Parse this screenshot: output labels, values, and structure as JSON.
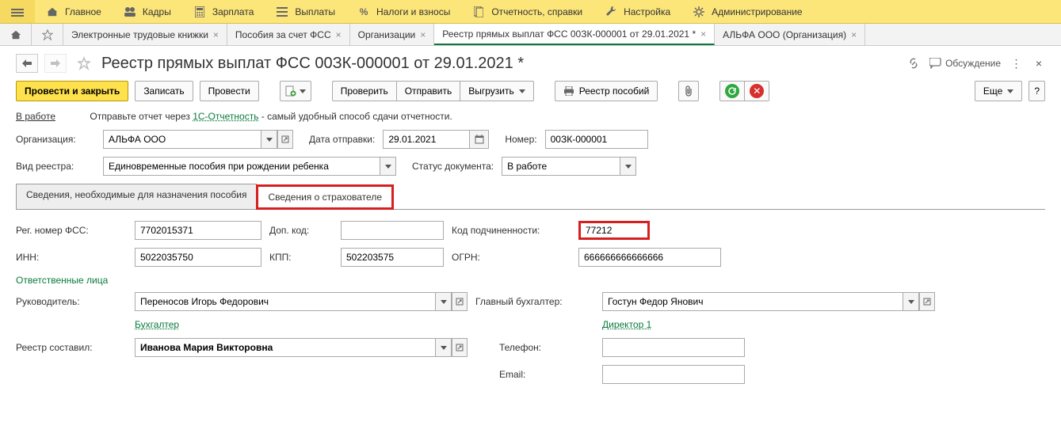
{
  "topmenu": {
    "items": [
      {
        "label": "Главное"
      },
      {
        "label": "Кадры"
      },
      {
        "label": "Зарплата"
      },
      {
        "label": "Выплаты"
      },
      {
        "label": "Налоги и взносы"
      },
      {
        "label": "Отчетность, справки"
      },
      {
        "label": "Настройка"
      },
      {
        "label": "Администрирование"
      }
    ]
  },
  "tabs": [
    {
      "label": "Электронные трудовые книжки",
      "active": false,
      "closable": true
    },
    {
      "label": "Пособия за счет ФСС",
      "active": false,
      "closable": true
    },
    {
      "label": "Организации",
      "active": false,
      "closable": true
    },
    {
      "label": "Реестр прямых выплат ФСС 00ЗК-000001 от 29.01.2021 *",
      "active": true,
      "closable": true
    },
    {
      "label": "АЛЬФА ООО (Организация)",
      "active": false,
      "closable": true
    }
  ],
  "title": "Реестр прямых выплат ФСС 00ЗК-000001 от 29.01.2021 *",
  "titlebar_right": {
    "discussion": "Обсуждение"
  },
  "toolbar": {
    "post_close": "Провести и закрыть",
    "save": "Записать",
    "post": "Провести",
    "check": "Проверить",
    "send": "Отправить",
    "export": "Выгрузить",
    "registry": "Реестр пособий",
    "more": "Еще"
  },
  "infoline": {
    "status": "В работе",
    "text_before": "Отправьте отчет через ",
    "link": "1С-Отчетность",
    "text_after": " - самый удобный способ сдачи отчетности."
  },
  "header_form": {
    "org_label": "Организация:",
    "org_value": "АЛЬФА ООО",
    "send_date_label": "Дата отправки:",
    "send_date_value": "29.01.2021",
    "number_label": "Номер:",
    "number_value": "00ЗК-000001",
    "registry_type_label": "Вид реестра:",
    "registry_type_value": "Единовременные пособия при рождении ребенка",
    "status_label": "Статус документа:",
    "status_value": "В работе"
  },
  "subtabs": {
    "tab1": "Сведения, необходимые для назначения пособия",
    "tab2": "Сведения о страхователе"
  },
  "insurer": {
    "reg_label": "Рег. номер ФСС:",
    "reg_value": "7702015371",
    "addcode_label": "Доп. код:",
    "addcode_value": "",
    "subord_label": "Код подчиненности:",
    "subord_value": "77212",
    "inn_label": "ИНН:",
    "inn_value": "5022035750",
    "kpp_label": "КПП:",
    "kpp_value": "502203575",
    "ogrn_label": "ОГРН:",
    "ogrn_value": "666666666666666"
  },
  "responsible": {
    "section": "Ответственные лица",
    "head_label": "Руководитель:",
    "head_value": "Переносов Игорь Федорович",
    "chief_acc_label": "Главный бухгалтер:",
    "chief_acc_value": "Гостун Федор Янович",
    "accountant_link": "Бухгалтер",
    "director_link": "Директор 1",
    "compiled_label": "Реестр составил:",
    "compiled_value": "Иванова Мария Викторовна",
    "phone_label": "Телефон:",
    "phone_value": "",
    "email_label": "Email:",
    "email_value": ""
  }
}
